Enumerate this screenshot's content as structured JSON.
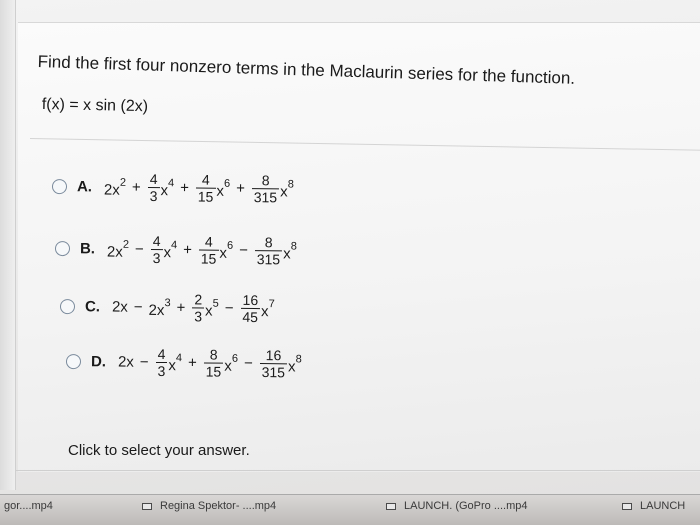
{
  "question": {
    "prompt": "Find the first four nonzero terms in the Maclaurin series for the function.",
    "function": "f(x) = x sin (2x)"
  },
  "choices": [
    {
      "letter": "A.",
      "terms": [
        {
          "t": "2x",
          "sup": "2"
        },
        {
          "op": "+"
        },
        {
          "num": "4",
          "den": "3"
        },
        {
          "t": "x",
          "sup": "4"
        },
        {
          "op": "+"
        },
        {
          "num": "4",
          "den": "15"
        },
        {
          "t": "x",
          "sup": "6"
        },
        {
          "op": "+"
        },
        {
          "num": "8",
          "den": "315"
        },
        {
          "t": "x",
          "sup": "8"
        }
      ]
    },
    {
      "letter": "B.",
      "terms": [
        {
          "t": "2x",
          "sup": "2"
        },
        {
          "op": "−"
        },
        {
          "num": "4",
          "den": "3"
        },
        {
          "t": "x",
          "sup": "4"
        },
        {
          "op": "+"
        },
        {
          "num": "4",
          "den": "15"
        },
        {
          "t": "x",
          "sup": "6"
        },
        {
          "op": "−"
        },
        {
          "num": "8",
          "den": "315"
        },
        {
          "t": "x",
          "sup": "8"
        }
      ]
    },
    {
      "letter": "C.",
      "terms": [
        {
          "t": "2x"
        },
        {
          "op": "−"
        },
        {
          "t": "2x",
          "sup": "3"
        },
        {
          "op": "+"
        },
        {
          "num": "2",
          "den": "3"
        },
        {
          "t": "x",
          "sup": "5"
        },
        {
          "op": "−"
        },
        {
          "num": "16",
          "den": "45"
        },
        {
          "t": "x",
          "sup": "7"
        }
      ]
    },
    {
      "letter": "D.",
      "terms": [
        {
          "t": "2x"
        },
        {
          "op": "−"
        },
        {
          "num": "4",
          "den": "3"
        },
        {
          "t": "x",
          "sup": "4"
        },
        {
          "op": "+"
        },
        {
          "num": "8",
          "den": "15"
        },
        {
          "t": "x",
          "sup": "6"
        },
        {
          "op": "−"
        },
        {
          "num": "16",
          "den": "315"
        },
        {
          "t": "x",
          "sup": "8"
        }
      ]
    }
  ],
  "footer": {
    "click_text": "Click to select your answer."
  },
  "taskbar": {
    "items": [
      "gor....mp4",
      "Regina Spektor- ....mp4",
      "LAUNCH. (GoPro ....mp4",
      "LAUNCH"
    ]
  },
  "colors": {
    "radio_border": "#7a8a9c",
    "text": "#1a1a1a",
    "background": "#f3f3f3"
  }
}
